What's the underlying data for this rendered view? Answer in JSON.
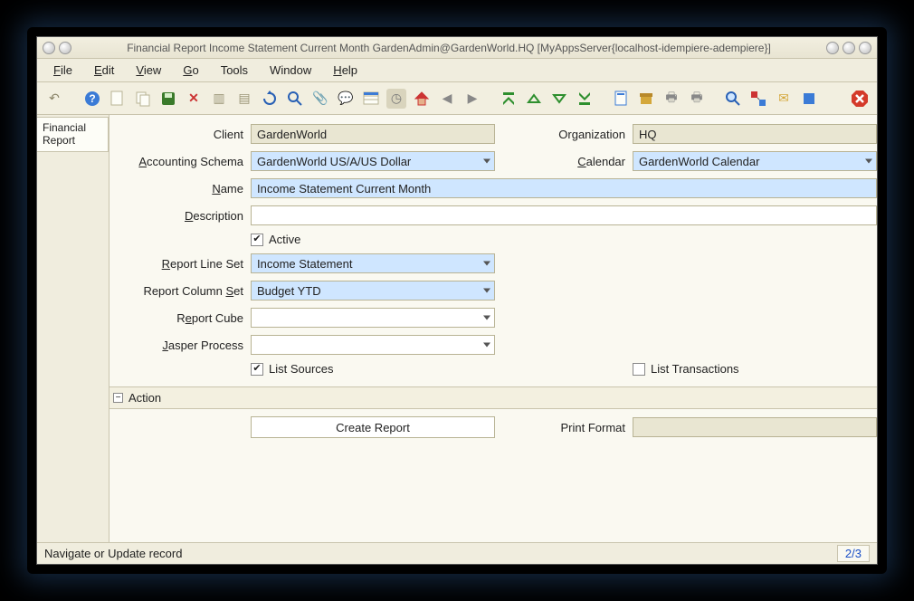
{
  "window": {
    "title": "Financial Report  Income Statement Current Month  GardenAdmin@GardenWorld.HQ [MyAppsServer{localhost-idempiere-adempiere}]"
  },
  "menu": {
    "file": "File",
    "edit": "Edit",
    "view": "View",
    "go": "Go",
    "tools": "Tools",
    "window": "Window",
    "help": "Help"
  },
  "sidebar": {
    "tab1_line1": "Financial",
    "tab1_line2": "Report"
  },
  "fields": {
    "client_label": "Client",
    "client_value": "GardenWorld",
    "organization_label": "Organization",
    "organization_value": "HQ",
    "acct_schema_label": "Accounting Schema",
    "acct_schema_value": "GardenWorld US/A/US Dollar",
    "calendar_label": "Calendar",
    "calendar_value": "GardenWorld Calendar",
    "name_label": "Name",
    "name_value": "Income Statement Current Month",
    "description_label": "Description",
    "description_value": "",
    "active_label": "Active",
    "active_checked": true,
    "report_line_set_label": "Report Line Set",
    "report_line_set_value": "Income Statement",
    "report_column_set_label": "Report Column Set",
    "report_column_set_value": "Budget YTD",
    "report_cube_label": "Report Cube",
    "report_cube_value": "",
    "jasper_process_label": "Jasper Process",
    "jasper_process_value": "",
    "list_sources_label": "List Sources",
    "list_sources_checked": true,
    "list_transactions_label": "List Transactions",
    "list_transactions_checked": false,
    "action_label": "Action",
    "create_report_label": "Create Report",
    "print_format_label": "Print Format",
    "print_format_value": ""
  },
  "status": {
    "left": "Navigate or Update record",
    "right": "2/3"
  }
}
